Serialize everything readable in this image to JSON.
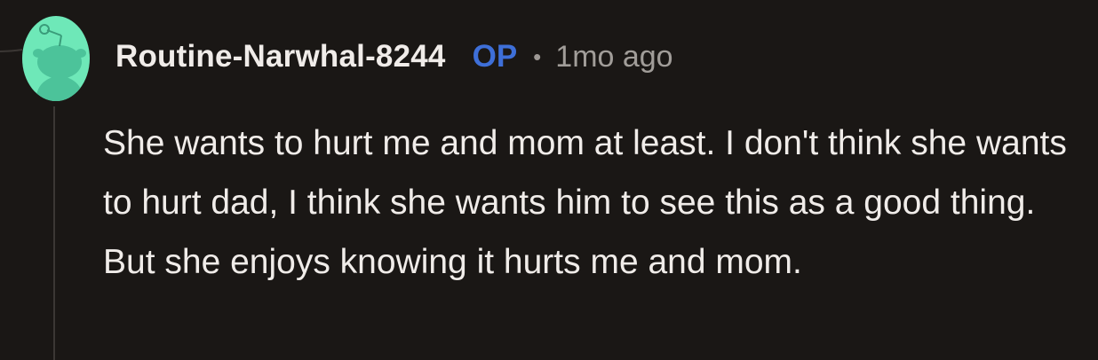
{
  "comment": {
    "author": "Routine-Narwhal-8244",
    "op_badge": "OP",
    "separator": "•",
    "timestamp": "1mo ago",
    "body": "She wants to hurt me and mom at least. I don't think she wants to hurt dad, I think she wants him to see this as a good thing. But she enjoys knowing it hurts me and mom."
  },
  "avatar": {
    "icon": "snoo-avatar-icon",
    "background_color": "#6ee8b8",
    "figure_color": "#4cc39a"
  },
  "colors": {
    "background": "#1a1715",
    "text": "#f0ece9",
    "op_badge": "#3e6fd8",
    "muted": "#a19d99",
    "thread_line": "#3b3734"
  }
}
